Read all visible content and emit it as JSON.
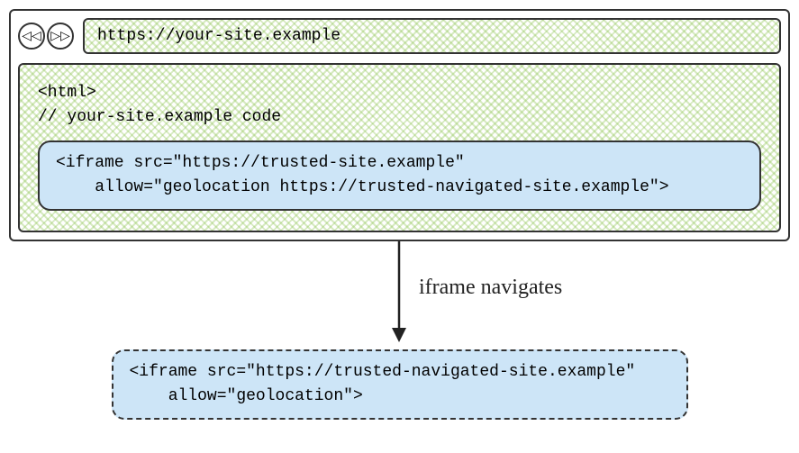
{
  "toolbar": {
    "back_icon": "◁◁",
    "forward_icon": "▷▷",
    "url": "https://your-site.example"
  },
  "viewport": {
    "line1": "<html>",
    "line2": "// your-site.example code",
    "iframe_code": "<iframe src=\"https://trusted-site.example\"\n    allow=\"geolocation https://trusted-navigated-site.example\">"
  },
  "arrow_label": "iframe navigates",
  "navigated_iframe_code": "<iframe src=\"https://trusted-navigated-site.example\"\n    allow=\"geolocation\">"
}
